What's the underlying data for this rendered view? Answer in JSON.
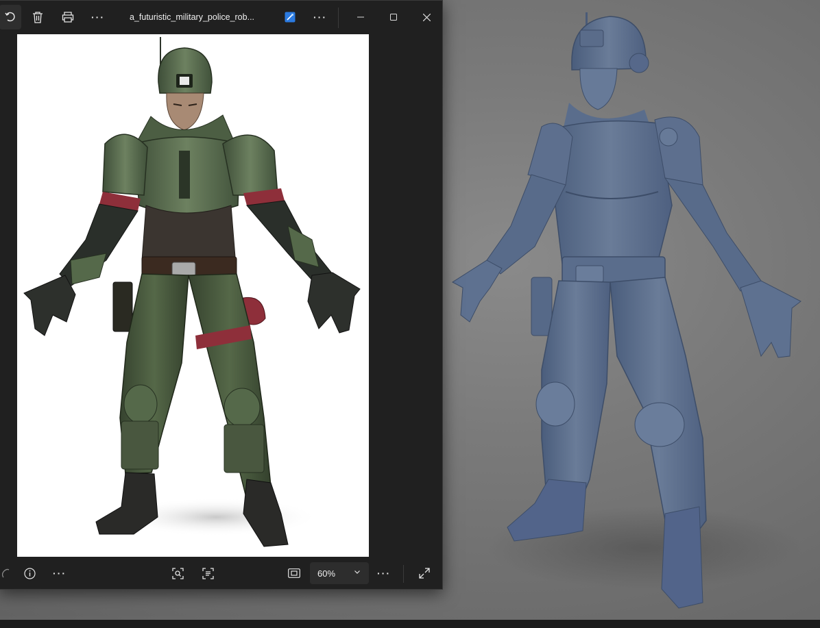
{
  "app": {
    "file_name": "a_futuristic_military_police_rob...",
    "zoom": {
      "value": "60%"
    }
  },
  "icons": {
    "rotate": "rotate-icon",
    "delete": "trash-icon",
    "print": "printer-icon",
    "more": "more-icon",
    "edit": "edit-image-icon",
    "minimize": "minimize-icon",
    "maximize": "maximize-icon",
    "close": "close-icon",
    "favorite": "heart-icon",
    "info": "info-icon",
    "visual_search": "visual-search-icon",
    "ocr": "scan-text-icon",
    "fit": "fit-to-window-icon",
    "fullscreen": "fullscreen-icon"
  },
  "colors": {
    "window_bg": "#202020",
    "accent": "#2b7ae0",
    "uniform_green": "#56684c",
    "model_blue": "#5b6f8d"
  }
}
